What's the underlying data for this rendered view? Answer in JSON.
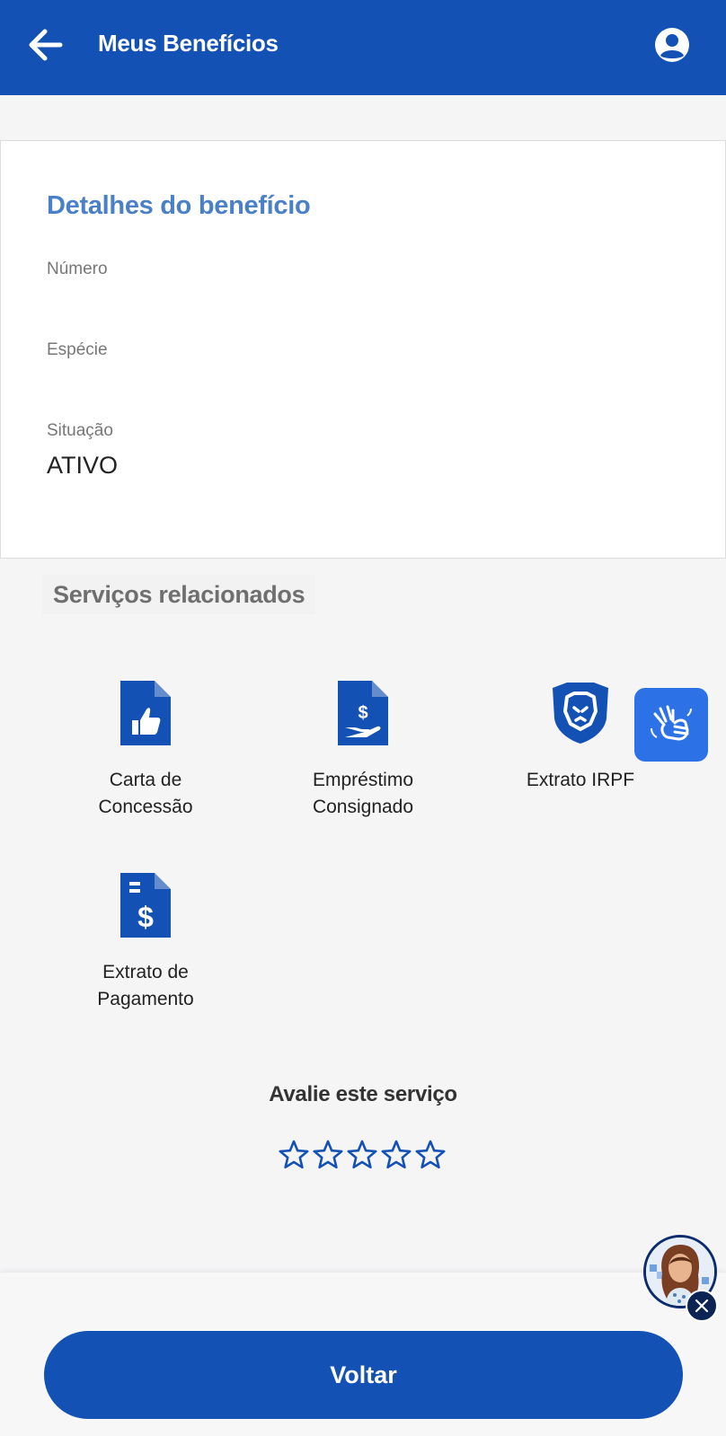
{
  "header": {
    "title": "Meus Benefícios",
    "back_icon": "arrow-left-icon",
    "profile_icon": "user-circle-icon",
    "bg_color": "#1351b4"
  },
  "details": {
    "title": "Detalhes do benefício",
    "numero_label": "Número",
    "numero_value": "",
    "especie_label": "Espécie",
    "especie_value": "",
    "situacao_label": "Situação",
    "situacao_value": "ATIVO"
  },
  "services": {
    "title": "Serviços relacionados",
    "items": [
      {
        "label": "Carta de\nConcessão",
        "icon": "document-thumbs-up-icon"
      },
      {
        "label": "Empréstimo\nConsignado",
        "icon": "document-hand-dollar-icon"
      },
      {
        "label": "Extrato IRPF",
        "icon": "lion-shield-icon"
      },
      {
        "label": "Extrato de\nPagamento",
        "icon": "document-dollar-icon"
      }
    ]
  },
  "libras": {
    "icon": "sign-language-hands-icon"
  },
  "rating": {
    "title": "Avalie este serviço",
    "max": 5,
    "value": 0
  },
  "footer": {
    "button_label": "Voltar"
  },
  "assistant": {
    "avatar_icon": "assistant-avatar-icon",
    "close_icon": "close-icon"
  }
}
